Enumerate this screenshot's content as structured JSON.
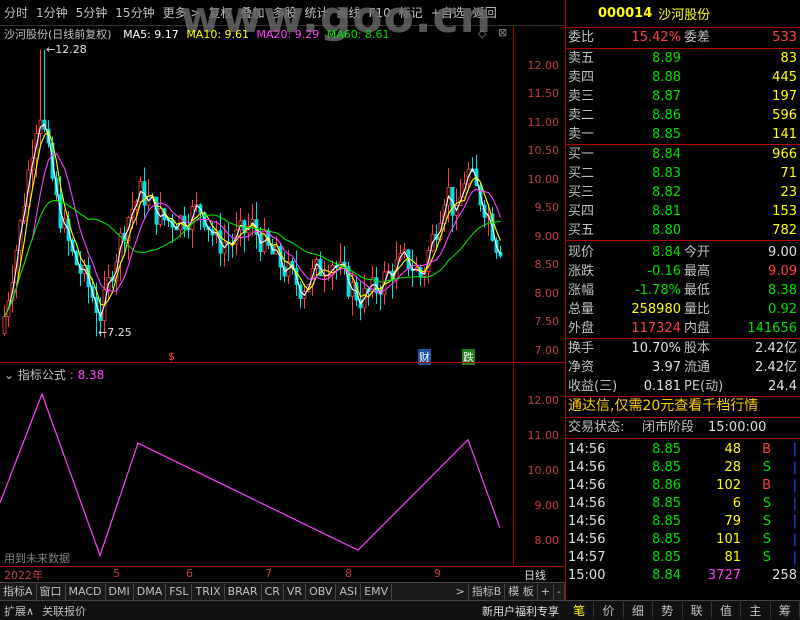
{
  "toolbar": {
    "items": [
      "分时",
      "1分钟",
      "5分钟",
      "15分钟",
      "更多 >",
      "复权",
      "叠加",
      "多股",
      "统计",
      "画线",
      "F10",
      "标记",
      "+自选",
      "返回"
    ]
  },
  "watermark": "www.goo.cn",
  "chart_header": {
    "stock": "沙河股份(日线前复权)",
    "ma5": "MA5: 9.17",
    "ma10": "MA10: 9.61",
    "ma20": "MA20: 9.29",
    "ma60": "MA60: 8.61"
  },
  "colors": {
    "ma5": "#ffffff",
    "ma10": "#ffff00",
    "ma20": "#ff40ff",
    "ma60": "#00e000",
    "up": "#ff4040",
    "down": "#00e0e0",
    "axis": "#c04040"
  },
  "price_axis": {
    "ticks": [
      "12.00",
      "11.50",
      "11.00",
      "10.50",
      "10.00",
      "9.50",
      "9.00",
      "8.50",
      "8.00",
      "7.50",
      "7.00"
    ]
  },
  "annotations": {
    "high": "←12.28",
    "low": "←7.25",
    "marker_s": "$",
    "marker_cai": "财",
    "marker_die": "跌"
  },
  "indicator": {
    "title": "指标公式",
    "value": ": 8.38",
    "axis": [
      "12.00",
      "11.00",
      "10.00",
      "9.00",
      "8.00"
    ],
    "future_note": "用到未来数据",
    "line_color": "#ff40ff"
  },
  "dates": {
    "year": "2022年",
    "months": [
      "5",
      "6",
      "7",
      "8",
      "9"
    ],
    "period": "日线"
  },
  "bottom_tabs": [
    "指标A",
    "窗口",
    "MACD",
    "DMI",
    "DMA",
    "FSL",
    "TRIX",
    "BRAR",
    "CR",
    "VR",
    "OBV",
    "ASI",
    "EMV",
    ">",
    "指标B",
    "模 板",
    "+",
    "-"
  ],
  "bottom_bar": {
    "left": [
      "扩展∧",
      "关联报价"
    ],
    "promo": "新用户福利专享"
  },
  "quote": {
    "code": "000014",
    "name": "沙河股份",
    "weibi_label": "委比",
    "weibi": "15.42%",
    "weicha_label": "委差",
    "weicha": "533",
    "asks": [
      {
        "label": "卖五",
        "price": "8.89",
        "vol": "83"
      },
      {
        "label": "卖四",
        "price": "8.88",
        "vol": "445"
      },
      {
        "label": "卖三",
        "price": "8.87",
        "vol": "197"
      },
      {
        "label": "卖二",
        "price": "8.86",
        "vol": "596"
      },
      {
        "label": "卖一",
        "price": "8.85",
        "vol": "141"
      }
    ],
    "bids": [
      {
        "label": "买一",
        "price": "8.84",
        "vol": "966"
      },
      {
        "label": "买二",
        "price": "8.83",
        "vol": "71"
      },
      {
        "label": "买三",
        "price": "8.82",
        "vol": "23"
      },
      {
        "label": "买四",
        "price": "8.81",
        "vol": "153"
      },
      {
        "label": "买五",
        "price": "8.80",
        "vol": "782"
      }
    ],
    "stats": [
      {
        "l1": "现价",
        "v1": "8.84",
        "c1": "green",
        "l2": "今开",
        "v2": "9.00",
        "c2": "white"
      },
      {
        "l1": "涨跌",
        "v1": "-0.16",
        "c1": "green",
        "l2": "最高",
        "v2": "9.09",
        "c2": "red"
      },
      {
        "l1": "涨幅",
        "v1": "-1.78%",
        "c1": "green",
        "l2": "最低",
        "v2": "8.38",
        "c2": "green"
      },
      {
        "l1": "总量",
        "v1": "258980",
        "c1": "yellow",
        "l2": "量比",
        "v2": "0.92",
        "c2": "green"
      },
      {
        "l1": "外盘",
        "v1": "117324",
        "c1": "red",
        "l2": "内盘",
        "v2": "141656",
        "c2": "green"
      }
    ],
    "fin": [
      {
        "l1": "换手",
        "v1": "10.70%",
        "l2": "股本",
        "v2": "2.42亿"
      },
      {
        "l1": "净资",
        "v1": "3.97",
        "l2": "流通",
        "v2": "2.42亿"
      },
      {
        "l1": "收益(三)",
        "v1": "0.181",
        "l2": "PE(动)",
        "v2": "24.4"
      }
    ],
    "ad": "通达信,仅需20元查看千档行情",
    "status_label": "交易状态:",
    "status": "闭市阶段",
    "status_time": "15:00:00",
    "ticks": [
      {
        "t": "14:56",
        "p": "8.85",
        "v": "48",
        "s": "B",
        "sc": "red"
      },
      {
        "t": "14:56",
        "p": "8.85",
        "v": "28",
        "s": "S",
        "sc": "green"
      },
      {
        "t": "14:56",
        "p": "8.86",
        "v": "102",
        "s": "B",
        "sc": "red"
      },
      {
        "t": "14:56",
        "p": "8.85",
        "v": "6",
        "s": "S",
        "sc": "green"
      },
      {
        "t": "14:56",
        "p": "8.85",
        "v": "79",
        "s": "S",
        "sc": "green"
      },
      {
        "t": "14:56",
        "p": "8.85",
        "v": "101",
        "s": "S",
        "sc": "green"
      },
      {
        "t": "14:57",
        "p": "8.85",
        "v": "81",
        "s": "S",
        "sc": "green"
      },
      {
        "t": "15:00",
        "p": "8.84",
        "v": "3727",
        "s": "258",
        "sc": "white"
      }
    ],
    "tabs": [
      "笔",
      "价",
      "细",
      "势",
      "联",
      "值",
      "主",
      "筹"
    ]
  }
}
